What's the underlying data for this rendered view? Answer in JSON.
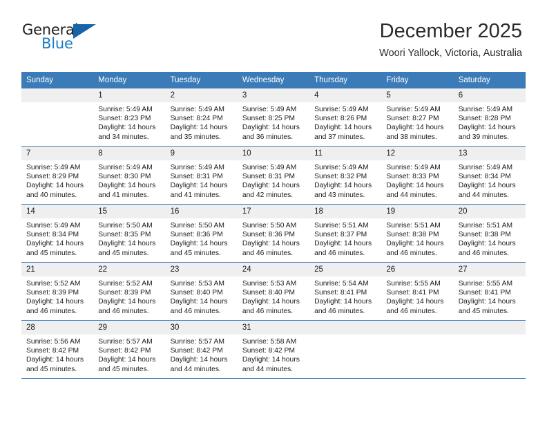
{
  "brand": {
    "name_top": "General",
    "name_bottom": "Blue",
    "color_dark": "#231f20",
    "color_blue": "#1a7dc4",
    "triangle_color": "#1565a8"
  },
  "header": {
    "month_title": "December 2025",
    "location": "Woori Yallock, Victoria, Australia"
  },
  "theme": {
    "header_row_bg": "#3b7cb8",
    "daynum_bg": "#efefef",
    "grid_line": "#3b7cb8"
  },
  "weekday_headers": [
    "Sunday",
    "Monday",
    "Tuesday",
    "Wednesday",
    "Thursday",
    "Friday",
    "Saturday"
  ],
  "weeks": [
    [
      {
        "day": "",
        "sunrise": "",
        "sunset": "",
        "daylight_1": "",
        "daylight_2": "",
        "empty": true
      },
      {
        "day": "1",
        "sunrise": "Sunrise: 5:49 AM",
        "sunset": "Sunset: 8:23 PM",
        "daylight_1": "Daylight: 14 hours",
        "daylight_2": "and 34 minutes."
      },
      {
        "day": "2",
        "sunrise": "Sunrise: 5:49 AM",
        "sunset": "Sunset: 8:24 PM",
        "daylight_1": "Daylight: 14 hours",
        "daylight_2": "and 35 minutes."
      },
      {
        "day": "3",
        "sunrise": "Sunrise: 5:49 AM",
        "sunset": "Sunset: 8:25 PM",
        "daylight_1": "Daylight: 14 hours",
        "daylight_2": "and 36 minutes."
      },
      {
        "day": "4",
        "sunrise": "Sunrise: 5:49 AM",
        "sunset": "Sunset: 8:26 PM",
        "daylight_1": "Daylight: 14 hours",
        "daylight_2": "and 37 minutes."
      },
      {
        "day": "5",
        "sunrise": "Sunrise: 5:49 AM",
        "sunset": "Sunset: 8:27 PM",
        "daylight_1": "Daylight: 14 hours",
        "daylight_2": "and 38 minutes."
      },
      {
        "day": "6",
        "sunrise": "Sunrise: 5:49 AM",
        "sunset": "Sunset: 8:28 PM",
        "daylight_1": "Daylight: 14 hours",
        "daylight_2": "and 39 minutes."
      }
    ],
    [
      {
        "day": "7",
        "sunrise": "Sunrise: 5:49 AM",
        "sunset": "Sunset: 8:29 PM",
        "daylight_1": "Daylight: 14 hours",
        "daylight_2": "and 40 minutes."
      },
      {
        "day": "8",
        "sunrise": "Sunrise: 5:49 AM",
        "sunset": "Sunset: 8:30 PM",
        "daylight_1": "Daylight: 14 hours",
        "daylight_2": "and 41 minutes."
      },
      {
        "day": "9",
        "sunrise": "Sunrise: 5:49 AM",
        "sunset": "Sunset: 8:31 PM",
        "daylight_1": "Daylight: 14 hours",
        "daylight_2": "and 41 minutes."
      },
      {
        "day": "10",
        "sunrise": "Sunrise: 5:49 AM",
        "sunset": "Sunset: 8:31 PM",
        "daylight_1": "Daylight: 14 hours",
        "daylight_2": "and 42 minutes."
      },
      {
        "day": "11",
        "sunrise": "Sunrise: 5:49 AM",
        "sunset": "Sunset: 8:32 PM",
        "daylight_1": "Daylight: 14 hours",
        "daylight_2": "and 43 minutes."
      },
      {
        "day": "12",
        "sunrise": "Sunrise: 5:49 AM",
        "sunset": "Sunset: 8:33 PM",
        "daylight_1": "Daylight: 14 hours",
        "daylight_2": "and 44 minutes."
      },
      {
        "day": "13",
        "sunrise": "Sunrise: 5:49 AM",
        "sunset": "Sunset: 8:34 PM",
        "daylight_1": "Daylight: 14 hours",
        "daylight_2": "and 44 minutes."
      }
    ],
    [
      {
        "day": "14",
        "sunrise": "Sunrise: 5:49 AM",
        "sunset": "Sunset: 8:34 PM",
        "daylight_1": "Daylight: 14 hours",
        "daylight_2": "and 45 minutes."
      },
      {
        "day": "15",
        "sunrise": "Sunrise: 5:50 AM",
        "sunset": "Sunset: 8:35 PM",
        "daylight_1": "Daylight: 14 hours",
        "daylight_2": "and 45 minutes."
      },
      {
        "day": "16",
        "sunrise": "Sunrise: 5:50 AM",
        "sunset": "Sunset: 8:36 PM",
        "daylight_1": "Daylight: 14 hours",
        "daylight_2": "and 45 minutes."
      },
      {
        "day": "17",
        "sunrise": "Sunrise: 5:50 AM",
        "sunset": "Sunset: 8:36 PM",
        "daylight_1": "Daylight: 14 hours",
        "daylight_2": "and 46 minutes."
      },
      {
        "day": "18",
        "sunrise": "Sunrise: 5:51 AM",
        "sunset": "Sunset: 8:37 PM",
        "daylight_1": "Daylight: 14 hours",
        "daylight_2": "and 46 minutes."
      },
      {
        "day": "19",
        "sunrise": "Sunrise: 5:51 AM",
        "sunset": "Sunset: 8:38 PM",
        "daylight_1": "Daylight: 14 hours",
        "daylight_2": "and 46 minutes."
      },
      {
        "day": "20",
        "sunrise": "Sunrise: 5:51 AM",
        "sunset": "Sunset: 8:38 PM",
        "daylight_1": "Daylight: 14 hours",
        "daylight_2": "and 46 minutes."
      }
    ],
    [
      {
        "day": "21",
        "sunrise": "Sunrise: 5:52 AM",
        "sunset": "Sunset: 8:39 PM",
        "daylight_1": "Daylight: 14 hours",
        "daylight_2": "and 46 minutes."
      },
      {
        "day": "22",
        "sunrise": "Sunrise: 5:52 AM",
        "sunset": "Sunset: 8:39 PM",
        "daylight_1": "Daylight: 14 hours",
        "daylight_2": "and 46 minutes."
      },
      {
        "day": "23",
        "sunrise": "Sunrise: 5:53 AM",
        "sunset": "Sunset: 8:40 PM",
        "daylight_1": "Daylight: 14 hours",
        "daylight_2": "and 46 minutes."
      },
      {
        "day": "24",
        "sunrise": "Sunrise: 5:53 AM",
        "sunset": "Sunset: 8:40 PM",
        "daylight_1": "Daylight: 14 hours",
        "daylight_2": "and 46 minutes."
      },
      {
        "day": "25",
        "sunrise": "Sunrise: 5:54 AM",
        "sunset": "Sunset: 8:41 PM",
        "daylight_1": "Daylight: 14 hours",
        "daylight_2": "and 46 minutes."
      },
      {
        "day": "26",
        "sunrise": "Sunrise: 5:55 AM",
        "sunset": "Sunset: 8:41 PM",
        "daylight_1": "Daylight: 14 hours",
        "daylight_2": "and 46 minutes."
      },
      {
        "day": "27",
        "sunrise": "Sunrise: 5:55 AM",
        "sunset": "Sunset: 8:41 PM",
        "daylight_1": "Daylight: 14 hours",
        "daylight_2": "and 45 minutes."
      }
    ],
    [
      {
        "day": "28",
        "sunrise": "Sunrise: 5:56 AM",
        "sunset": "Sunset: 8:42 PM",
        "daylight_1": "Daylight: 14 hours",
        "daylight_2": "and 45 minutes."
      },
      {
        "day": "29",
        "sunrise": "Sunrise: 5:57 AM",
        "sunset": "Sunset: 8:42 PM",
        "daylight_1": "Daylight: 14 hours",
        "daylight_2": "and 45 minutes."
      },
      {
        "day": "30",
        "sunrise": "Sunrise: 5:57 AM",
        "sunset": "Sunset: 8:42 PM",
        "daylight_1": "Daylight: 14 hours",
        "daylight_2": "and 44 minutes."
      },
      {
        "day": "31",
        "sunrise": "Sunrise: 5:58 AM",
        "sunset": "Sunset: 8:42 PM",
        "daylight_1": "Daylight: 14 hours",
        "daylight_2": "and 44 minutes."
      },
      {
        "day": "",
        "sunrise": "",
        "sunset": "",
        "daylight_1": "",
        "daylight_2": "",
        "empty": true
      },
      {
        "day": "",
        "sunrise": "",
        "sunset": "",
        "daylight_1": "",
        "daylight_2": "",
        "empty": true
      },
      {
        "day": "",
        "sunrise": "",
        "sunset": "",
        "daylight_1": "",
        "daylight_2": "",
        "empty": true
      }
    ]
  ]
}
